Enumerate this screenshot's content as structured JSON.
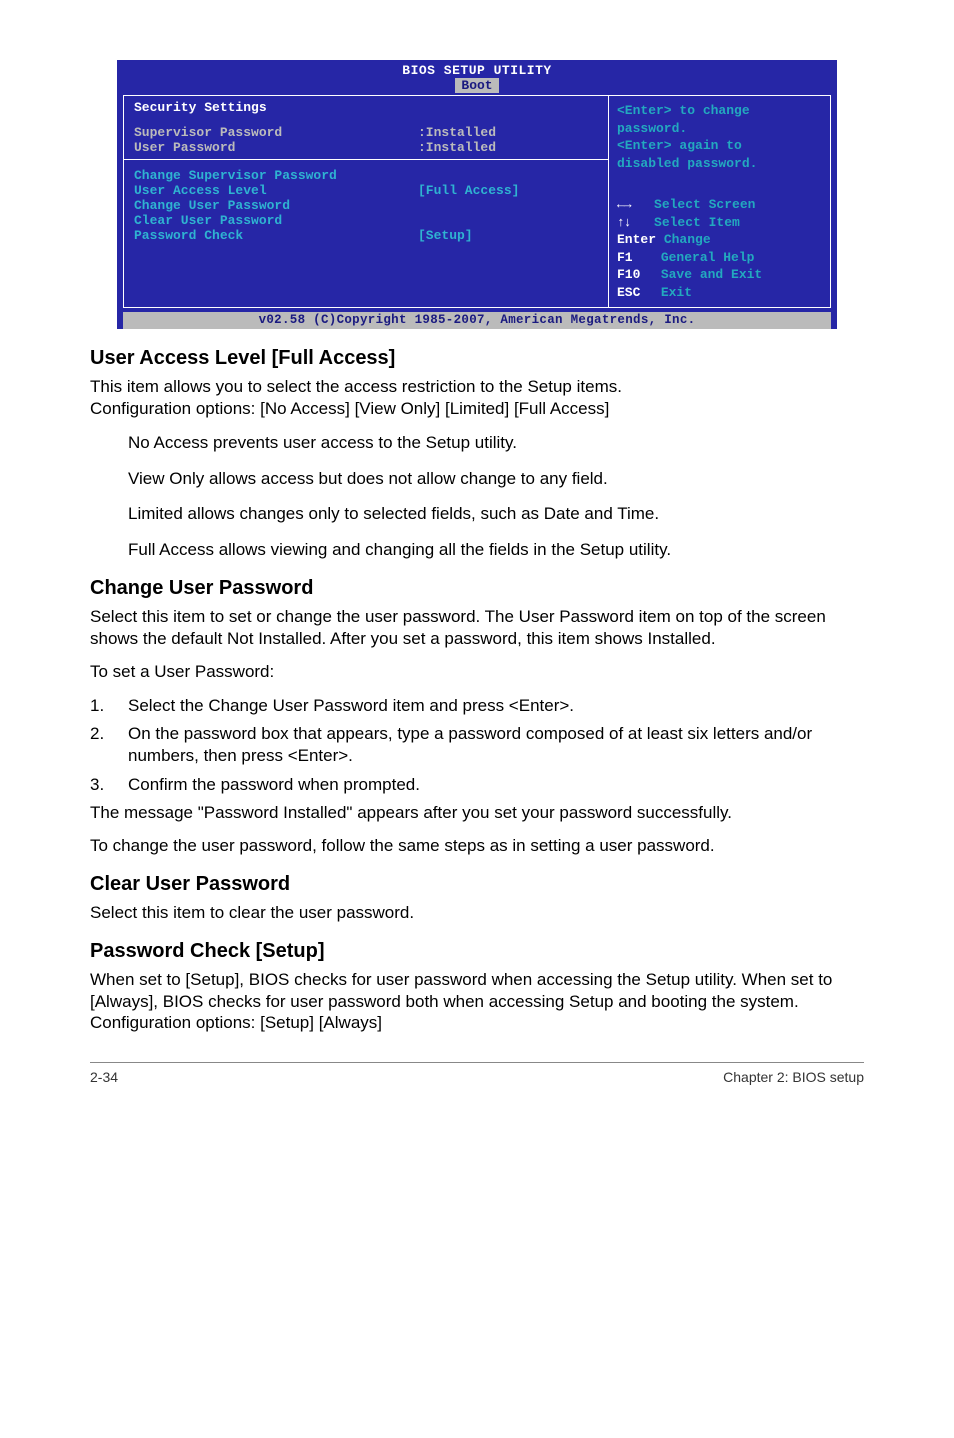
{
  "bios": {
    "title": "BIOS SETUP UTILITY",
    "tab": "Boot",
    "left_top": {
      "heading": "Security Settings"
    },
    "passwords": {
      "sup_label": "Supervisor Password",
      "sup_value": ":Installed",
      "user_label": "User Password",
      "user_value": ":Installed"
    },
    "items": {
      "change_sup": "Change Supervisor Password",
      "access_level_lbl": "User Access Level",
      "access_level_val": "[Full Access]",
      "change_user": "Change User Password",
      "clear_user": "Clear User Password",
      "pw_check_lbl": "Password Check",
      "pw_check_val": "[Setup]"
    },
    "help_top": {
      "line1": "<Enter> to change",
      "line2": "password.",
      "line3": "<Enter> again to",
      "line4": "disabled password."
    },
    "help_bottom": {
      "lr_arrows": "←→",
      "lr_text": "Select Screen",
      "ud_arrows": "↑↓",
      "ud_text": "Select Item",
      "enter_key": "Enter",
      "enter_text": "Change",
      "f1_key": "F1",
      "f1_text": "General Help",
      "f10_key": "F10",
      "f10_text": "Save and Exit",
      "esc_key": "ESC",
      "esc_text": "Exit"
    },
    "footer": "v02.58 (C)Copyright 1985-2007, American Megatrends, Inc."
  },
  "doc": {
    "h1": "User Access Level [Full Access]",
    "h1_p1": "This item allows you to select the access restriction to the Setup items.",
    "h1_p2": "Configuration options: [No Access] [View Only] [Limited] [Full Access]",
    "bullets": {
      "b1": "No Access prevents user access to the Setup utility.",
      "b2": "View Only allows access but does not allow change to any field.",
      "b3": "Limited allows changes only to selected fields, such as Date and Time.",
      "b4": "Full Access allows viewing and changing all the fields in the Setup utility."
    },
    "h2": "Change User Password",
    "h2_p1": "Select this item to set or change the user password. The User Password item on top of the screen shows the default Not Installed. After you set a password, this item shows Installed.",
    "h2_p2": "To set a User Password:",
    "steps": {
      "s1": "Select the Change User Password item and press <Enter>.",
      "s2": "On the password box that appears, type a password composed of at least six letters and/or numbers, then press <Enter>.",
      "s3": "Confirm the password when prompted."
    },
    "h2_p3": "The message \"Password Installed\" appears after you set your password successfully.",
    "h2_p4": "To change the user password, follow the same steps as in setting a user password.",
    "h3": "Clear User Password",
    "h3_p1": "Select this item to clear the user password.",
    "h4": "Password Check [Setup]",
    "h4_p1": "When set to [Setup], BIOS checks for user password when accessing the Setup utility. When set to [Always], BIOS checks for user password both when accessing Setup and booting the system.",
    "h4_p2": "Configuration options: [Setup] [Always]"
  },
  "footer": {
    "left": "2-34",
    "right": "Chapter 2: BIOS setup"
  }
}
